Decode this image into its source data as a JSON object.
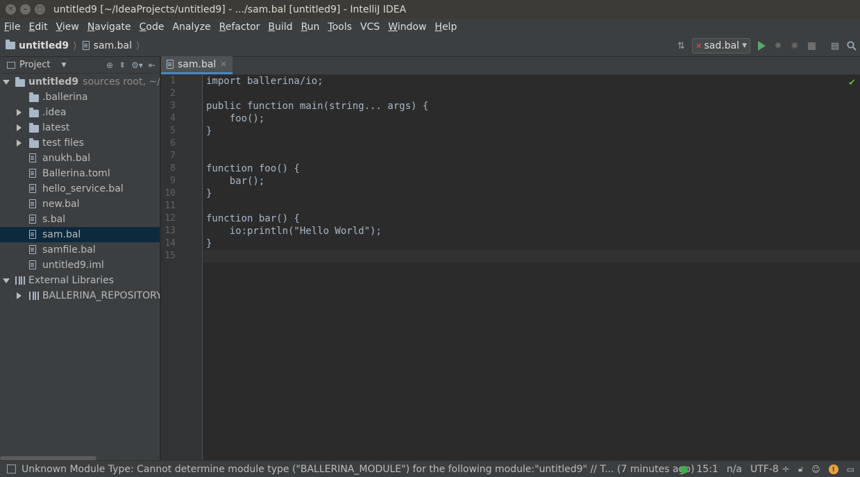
{
  "window": {
    "title": "untitled9 [~/IdeaProjects/untitled9] - .../sam.bal [untitled9] - IntelliJ IDEA"
  },
  "menu": [
    {
      "label": "File",
      "mnemonic": "F",
      "rest": "ile"
    },
    {
      "label": "Edit",
      "mnemonic": "E",
      "rest": "dit"
    },
    {
      "label": "View",
      "mnemonic": "V",
      "rest": "iew"
    },
    {
      "label": "Navigate",
      "mnemonic": "N",
      "rest": "avigate"
    },
    {
      "label": "Code",
      "mnemonic": "C",
      "rest": "ode"
    },
    {
      "label": "Analyze",
      "mnemonic": "",
      "rest": "Analyze"
    },
    {
      "label": "Refactor",
      "mnemonic": "R",
      "rest": "efactor"
    },
    {
      "label": "Build",
      "mnemonic": "B",
      "rest": "uild"
    },
    {
      "label": "Run",
      "mnemonic": "R",
      "rest": "un"
    },
    {
      "label": "Tools",
      "mnemonic": "T",
      "rest": "ools"
    },
    {
      "label": "VCS",
      "mnemonic": "",
      "rest": "VCS"
    },
    {
      "label": "Window",
      "mnemonic": "W",
      "rest": "indow"
    },
    {
      "label": "Help",
      "mnemonic": "H",
      "rest": "elp"
    }
  ],
  "breadcrumb": {
    "project": "untitled9",
    "file": "sam.bal"
  },
  "run_config": {
    "label": "sad.bal"
  },
  "project_panel": {
    "title": "Project",
    "tree": [
      {
        "label": "untitled9",
        "hint": "sources root, ~/Id",
        "level": 0,
        "arrow": "down",
        "icon": "module-folder-icon",
        "bold": true
      },
      {
        "label": ".ballerina",
        "level": 1,
        "arrow": "",
        "icon": "folder-icon"
      },
      {
        "label": ".idea",
        "level": 1,
        "arrow": "right",
        "icon": "folder-icon"
      },
      {
        "label": "latest",
        "level": 1,
        "arrow": "right",
        "icon": "folder-icon"
      },
      {
        "label": "test files",
        "level": 1,
        "arrow": "right",
        "icon": "folder-icon"
      },
      {
        "label": "anukh.bal",
        "level": 1,
        "arrow": "",
        "icon": "file-icon"
      },
      {
        "label": "Ballerina.toml",
        "level": 1,
        "arrow": "",
        "icon": "toml-file-icon"
      },
      {
        "label": "hello_service.bal",
        "level": 1,
        "arrow": "",
        "icon": "file-icon"
      },
      {
        "label": "new.bal",
        "level": 1,
        "arrow": "",
        "icon": "file-icon"
      },
      {
        "label": "s.bal",
        "level": 1,
        "arrow": "",
        "icon": "file-icon"
      },
      {
        "label": "sam.bal",
        "level": 1,
        "arrow": "",
        "icon": "file-icon",
        "selected": true
      },
      {
        "label": "samfile.bal",
        "level": 1,
        "arrow": "",
        "icon": "file-icon"
      },
      {
        "label": "untitled9.iml",
        "level": 1,
        "arrow": "",
        "icon": "iml-file-icon"
      },
      {
        "label": "External Libraries",
        "level": 0,
        "arrow": "down",
        "icon": "library-icon"
      },
      {
        "label": "BALLERINA_REPOSITORY",
        "level": 1,
        "arrow": "right",
        "icon": "library-icon"
      }
    ]
  },
  "editor": {
    "tab": "sam.bal",
    "lines": [
      "import ballerina/io;",
      "",
      "public function main(string... args) {",
      "    foo();",
      "}",
      "",
      "",
      "function foo() {",
      "    bar();",
      "}",
      "",
      "function bar() {",
      "    io:println(\"Hello World\");",
      "}",
      ""
    ],
    "current_line": 15
  },
  "status": {
    "message": "Unknown Module Type: Cannot determine module type (\"BALLERINA_MODULE\") for the following module:\"untitled9\" // T... (7 minutes ago)",
    "position": "15:1",
    "na": "n/a",
    "encoding": "UTF-8 ÷"
  }
}
